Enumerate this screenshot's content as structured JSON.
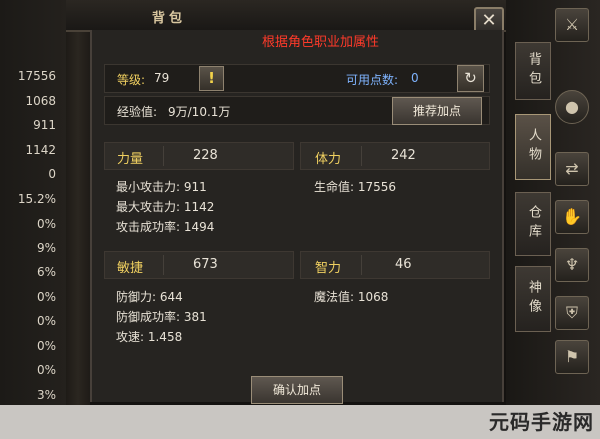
{
  "left_stats": [
    "17556",
    "1068",
    "911",
    "1142",
    "0",
    "15.2%",
    "0%",
    "9%",
    "6%",
    "0%",
    "0%",
    "0%",
    "0%",
    "3%"
  ],
  "title": "背包",
  "close_label": "✕",
  "note": "根据角色职业加属性",
  "level": {
    "label": "等级:",
    "value": "79"
  },
  "warn_icon": "!",
  "points": {
    "label": "可用点数:",
    "value": "0"
  },
  "refresh_icon": "↻",
  "exp": {
    "label": "经验值:",
    "value": "9万/10.1万"
  },
  "recommend_button": "推荐加点",
  "attributes": {
    "strength": {
      "name": "力量",
      "value": "228"
    },
    "stamina": {
      "name": "体力",
      "value": "242"
    },
    "agility": {
      "name": "敏捷",
      "value": "673"
    },
    "intellect": {
      "name": "智力",
      "value": "46"
    }
  },
  "details": {
    "min_attack": "最小攻击力: 911",
    "max_attack": "最大攻击力: 1142",
    "hit_rate": "攻击成功率: 1494",
    "hp": "生命值: 17556",
    "defense": "防御力: 644",
    "def_rate": "防御成功率: 381",
    "attack_speed": "攻速: 1.458",
    "magic_def": "魔法值: 1068"
  },
  "confirm_button": "确认加点",
  "side_tabs": [
    "背包",
    "人物",
    "仓库",
    "神像"
  ],
  "watermark": "元码手游网"
}
